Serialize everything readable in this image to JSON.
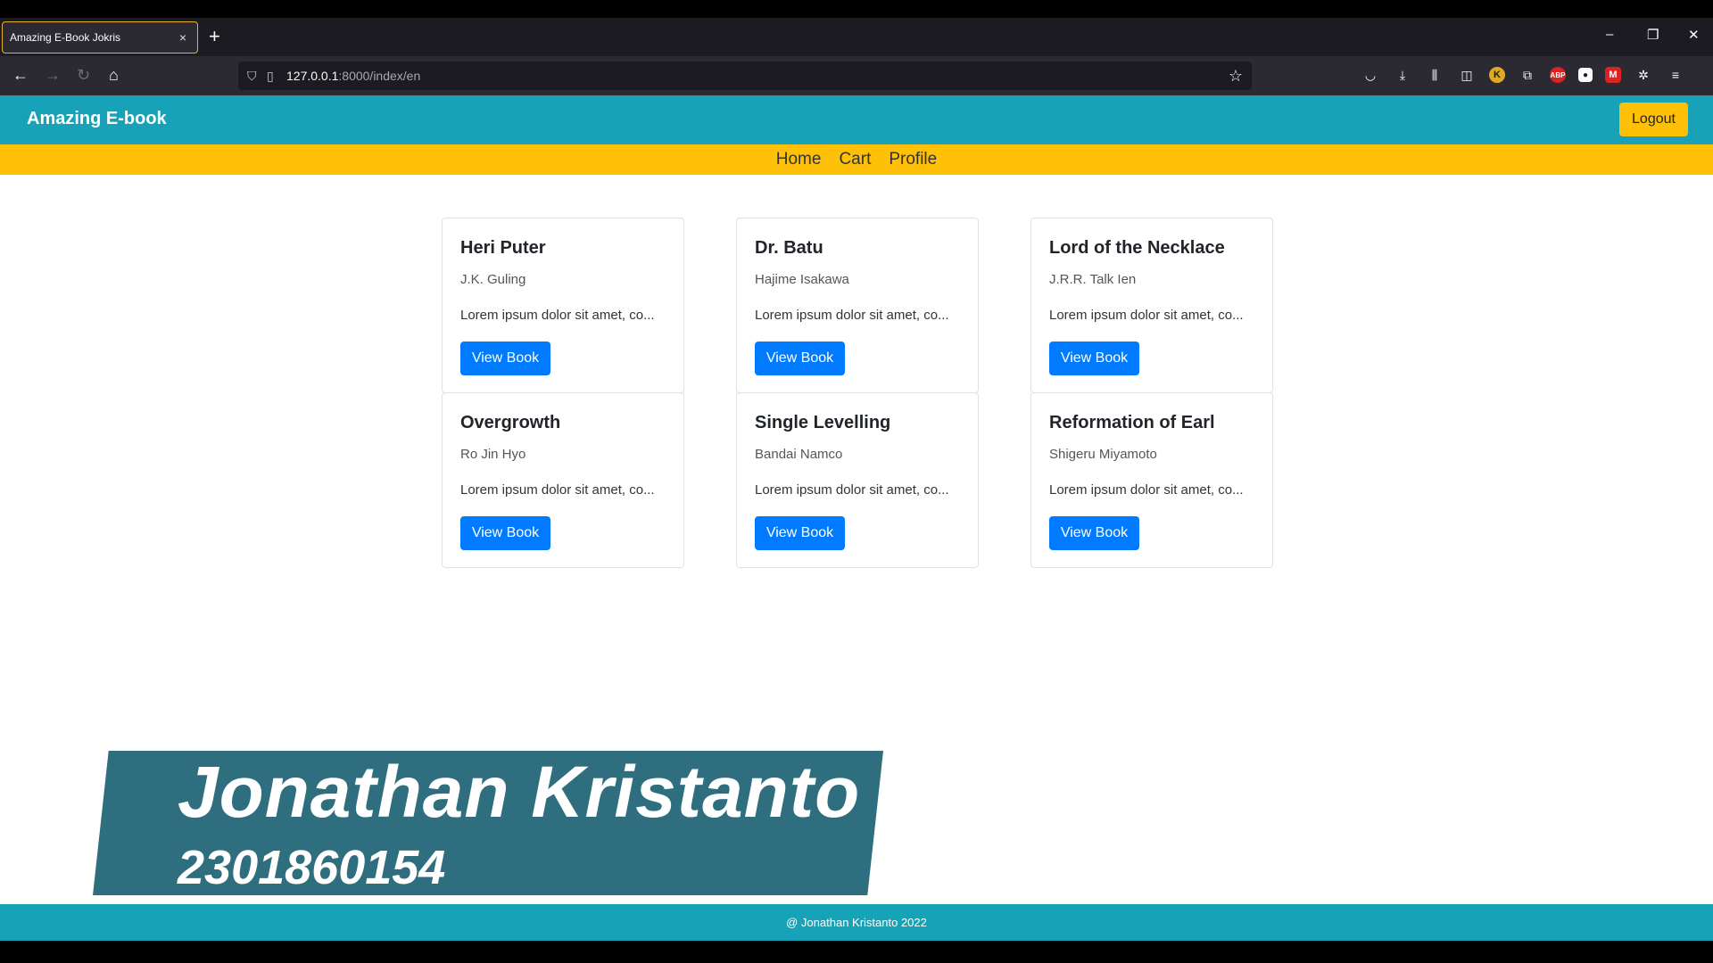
{
  "browser": {
    "tab_title": "Amazing E-Book Jokris",
    "tab_close": "×",
    "new_tab": "+",
    "url_host": "127.0.0.1",
    "url_rest": ":8000/index/en",
    "window_controls": [
      "–",
      "❐",
      "✕"
    ]
  },
  "header": {
    "brand": "Amazing E-book",
    "logout_label": "Logout"
  },
  "menu": {
    "items": [
      "Home",
      "Cart",
      "Profile"
    ]
  },
  "books": [
    {
      "title": "Heri Puter",
      "author": "J.K. Guling",
      "desc": "Lorem ipsum dolor sit amet, co...",
      "button": "View Book"
    },
    {
      "title": "Dr. Batu",
      "author": "Hajime Isakawa",
      "desc": "Lorem ipsum dolor sit amet, co...",
      "button": "View Book"
    },
    {
      "title": "Lord of the Necklace",
      "author": "J.R.R. Talk Ien",
      "desc": "Lorem ipsum dolor sit amet, co...",
      "button": "View Book"
    },
    {
      "title": "Overgrowth",
      "author": "Ro Jin Hyo",
      "desc": "Lorem ipsum dolor sit amet, co...",
      "button": "View Book"
    },
    {
      "title": "Single Levelling",
      "author": "Bandai Namco",
      "desc": "Lorem ipsum dolor sit amet, co...",
      "button": "View Book"
    },
    {
      "title": "Reformation of Earl",
      "author": "Shigeru Miyamoto",
      "desc": "Lorem ipsum dolor sit amet, co...",
      "button": "View Book"
    }
  ],
  "banner": {
    "name": "Jonathan Kristanto",
    "id": "2301860154"
  },
  "footer": {
    "text": "@ Jonathan Kristanto 2022"
  },
  "colors": {
    "header": "#17a2b8",
    "menubar": "#ffc107",
    "button": "#007bff",
    "banner": "#2f6e7e"
  }
}
